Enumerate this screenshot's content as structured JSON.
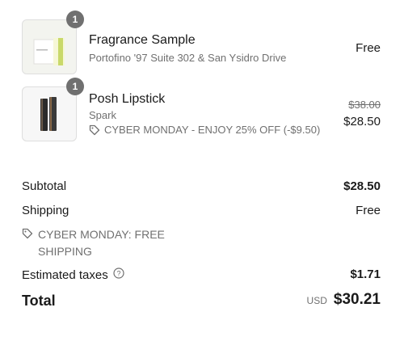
{
  "items": [
    {
      "quantity": "1",
      "name": "Fragrance Sample",
      "variant": "Portofino '97 Suite 302 & San Ysidro Drive",
      "price": "Free"
    },
    {
      "quantity": "1",
      "name": "Posh Lipstick",
      "variant": "Spark",
      "discount": "CYBER MONDAY - ENJOY 25% OFF (-$9.50)",
      "original_price": "$38.00",
      "price": "$28.50"
    }
  ],
  "summary": {
    "subtotal_label": "Subtotal",
    "subtotal_value": "$28.50",
    "shipping_label": "Shipping",
    "shipping_value": "Free",
    "shipping_discount_line1": "CYBER MONDAY: FREE",
    "shipping_discount_line2": "SHIPPING",
    "taxes_label": "Estimated taxes",
    "taxes_value": "$1.71",
    "total_label": "Total",
    "currency": "USD",
    "total_value": "$30.21"
  },
  "colors": {
    "text": "#1a1a1a",
    "muted": "#707070",
    "badge": "#707070"
  }
}
